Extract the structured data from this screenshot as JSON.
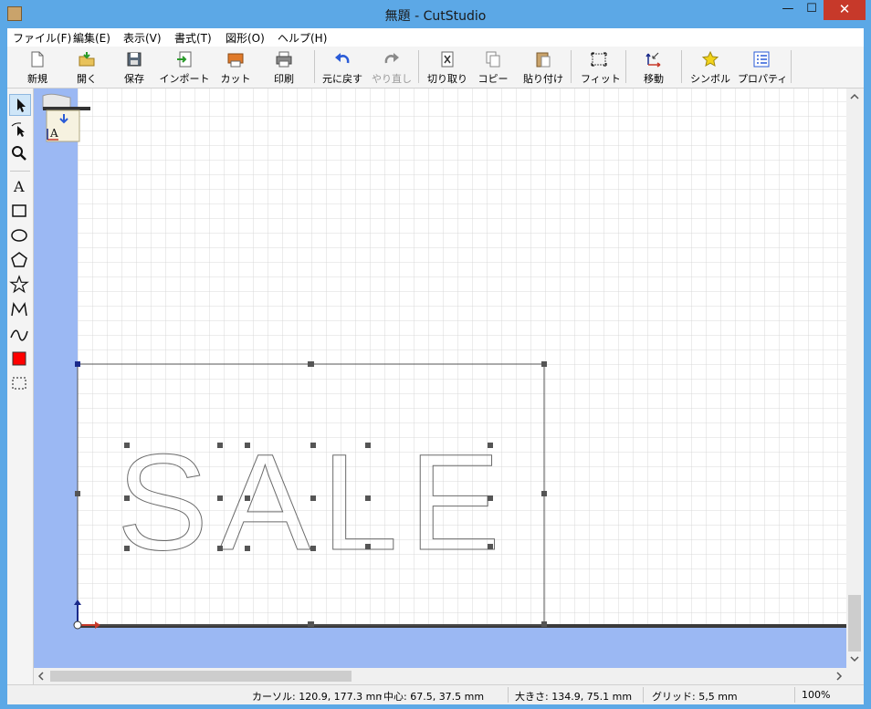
{
  "window": {
    "title": "無題 - CutStudio",
    "minimize_label": "—",
    "maximize_label": "☐",
    "close_label": "✕"
  },
  "menu": [
    {
      "label": "ファイル(F)"
    },
    {
      "label": "編集(E)"
    },
    {
      "label": "表示(V)"
    },
    {
      "label": "書式(T)"
    },
    {
      "label": "図形(O)"
    },
    {
      "label": "ヘルプ(H)"
    }
  ],
  "toolbar": {
    "new": "新規",
    "open": "開く",
    "save": "保存",
    "import": "インポート",
    "cut": "カット",
    "print": "印刷",
    "undo": "元に戻す",
    "redo": "やり直し",
    "cut2": "切り取り",
    "copy": "コピー",
    "paste": "貼り付け",
    "fit": "フィット",
    "move": "移動",
    "symbol": "シンボル",
    "properties": "プロパティ"
  },
  "canvas": {
    "text": "SALE",
    "accent": "#2a5bd7",
    "background": "#9bb8f3"
  },
  "status": {
    "cursor": "カーソル: 120.9, 177.3 mm",
    "center": "中心: 67.5, 37.5 mm",
    "size": "大きさ: 134.9, 75.1 mm",
    "grid": "グリッド: 5,5 mm",
    "zoom": "100%"
  }
}
